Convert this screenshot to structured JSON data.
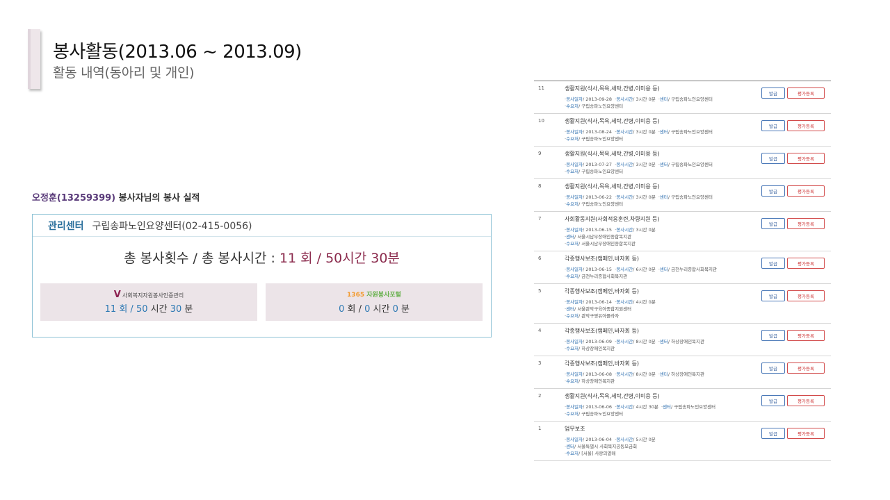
{
  "header": {
    "title": "봉사활동(2013.06   ~ 2013.09)",
    "subtitle": "활동 내역(동아리 및 개인)"
  },
  "summary": {
    "volunteer_name": "오정훈(13259399)",
    "heading_suffix": " 봉사자님의 봉사 실적",
    "center_label": "관리센터",
    "center_value": "구립송파노인요양센터(02-415-0056)",
    "total_label": "총 봉사횟수 / 총 봉사시간 : ",
    "total_value": "11 회 / 50시간 30분",
    "cards": [
      {
        "logo_mark": "V",
        "logo_text": "사회복지자원봉사인증관리",
        "count": "11",
        "count_unit": " 회 / ",
        "hours": "50",
        "hours_unit": " 시간 ",
        "minutes": "30",
        "minutes_unit": " 분"
      },
      {
        "logo_text_a": "1365",
        "logo_text_b": " 자원봉사포털",
        "count": "0",
        "count_unit": " 회 / ",
        "hours": "0",
        "hours_unit": " 시간 ",
        "minutes": "0",
        "minutes_unit": " 분"
      }
    ]
  },
  "labels": {
    "date_key": "봉사일자",
    "time_key": "봉사시간",
    "center_key": "센터",
    "recipient_key": "수요처",
    "issue_button": "발급",
    "eval_button": "평가등록"
  },
  "records": [
    {
      "num": "11",
      "category": "생활지원(식사,목욕,세탁,간병,이미용 등)",
      "date": "2013-09-28",
      "time": "3시간 0분",
      "center": "구립송파노인요양센터",
      "recipient": "구립송파노인요양센터"
    },
    {
      "num": "10",
      "category": "생활지원(식사,목욕,세탁,간병,이미용 등)",
      "date": "2013-08-24",
      "time": "3시간 0분",
      "center": "구립송파노인요양센터",
      "recipient": "구립송파노인요양센터"
    },
    {
      "num": "9",
      "category": "생활지원(식사,목욕,세탁,간병,이미용 등)",
      "date": "2013-07-27",
      "time": "3시간 0분",
      "center": "구립송파노인요양센터",
      "recipient": "구립송파노인요양센터"
    },
    {
      "num": "8",
      "category": "생활지원(식사,목욕,세탁,간병,이미용 등)",
      "date": "2013-06-22",
      "time": "3시간 0분",
      "center": "구립송파노인요양센터",
      "recipient": "구립송파노인요양센터"
    },
    {
      "num": "7",
      "category": "사회활동지원(사회적응훈련,차량지원 등)",
      "date": "2013-06-15",
      "time": "3시간 0분",
      "center": "서울시남부장애인종합복지관",
      "recipient": "서울시남부장애인종합복지관",
      "center_newline": true
    },
    {
      "num": "6",
      "category": "각종행사보조(캠페인,바자회 등)",
      "date": "2013-06-15",
      "time": "6시간 0분",
      "center": "금천누리종합사회복지관",
      "recipient": "금천누리종합사회복지관"
    },
    {
      "num": "5",
      "category": "각종행사보조(캠페인,바자회 등)",
      "date": "2013-06-14",
      "time": "4시간 0분",
      "center": "서울관악구육아종합지원센터",
      "recipient": "관악구영유아플라자",
      "center_newline": true
    },
    {
      "num": "4",
      "category": "각종행사보조(캠페인,바자회 등)",
      "date": "2013-06-09",
      "time": "8시간 0분",
      "center": "하상장애인복지관",
      "recipient": "하상장애인복지관"
    },
    {
      "num": "3",
      "category": "각종행사보조(캠페인,바자회 등)",
      "date": "2013-06-08",
      "time": "8시간 0분",
      "center": "하상장애인복지관",
      "recipient": "하상장애인복지관"
    },
    {
      "num": "2",
      "category": "생활지원(식사,목욕,세탁,간병,이미용 등)",
      "date": "2013-06-06",
      "time": "4시간 30분",
      "center": "구립송파노인요양센터",
      "recipient": "구립송파노인요양센터"
    },
    {
      "num": "1",
      "category": "업무보조",
      "date": "2013-06-04",
      "time": "5시간 0분",
      "center": "서울특별시 사회복지공동모금회",
      "recipient": "[서울] 사랑의열매",
      "center_newline": true
    }
  ]
}
